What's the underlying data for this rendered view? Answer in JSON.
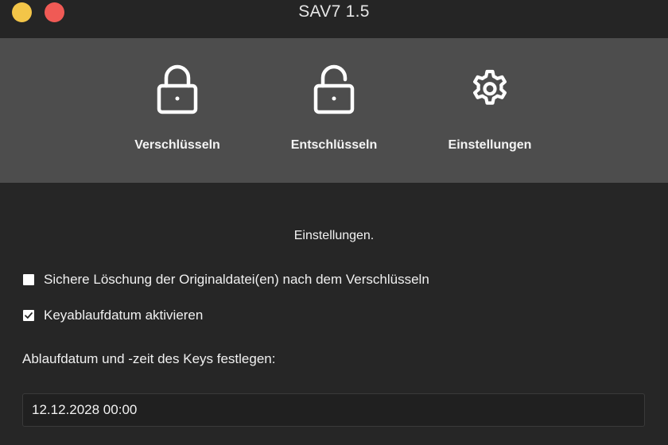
{
  "window": {
    "title": "SAV7 1.5",
    "controls": {
      "minimize_color": "#f3c548",
      "close_color": "#f05a55"
    }
  },
  "toolbar": {
    "items": [
      {
        "label": "Verschlüsseln",
        "icon": "lock-closed-icon"
      },
      {
        "label": "Entschlüsseln",
        "icon": "lock-open-icon"
      },
      {
        "label": "Einstellungen",
        "icon": "gear-icon"
      }
    ],
    "background": "#4d4d4d"
  },
  "settings": {
    "title": "Einstellungen.",
    "secure_delete": {
      "label": "Sichere Löschung der Originaldatei(en) nach dem Verschlüsseln",
      "checked": false
    },
    "key_expiry": {
      "label": "Keyablaufdatum aktivieren",
      "checked": true
    },
    "expiry_field_label": "Ablaufdatum und -zeit des Keys festlegen:",
    "expiry_value": "12.12.2028 00:00"
  }
}
